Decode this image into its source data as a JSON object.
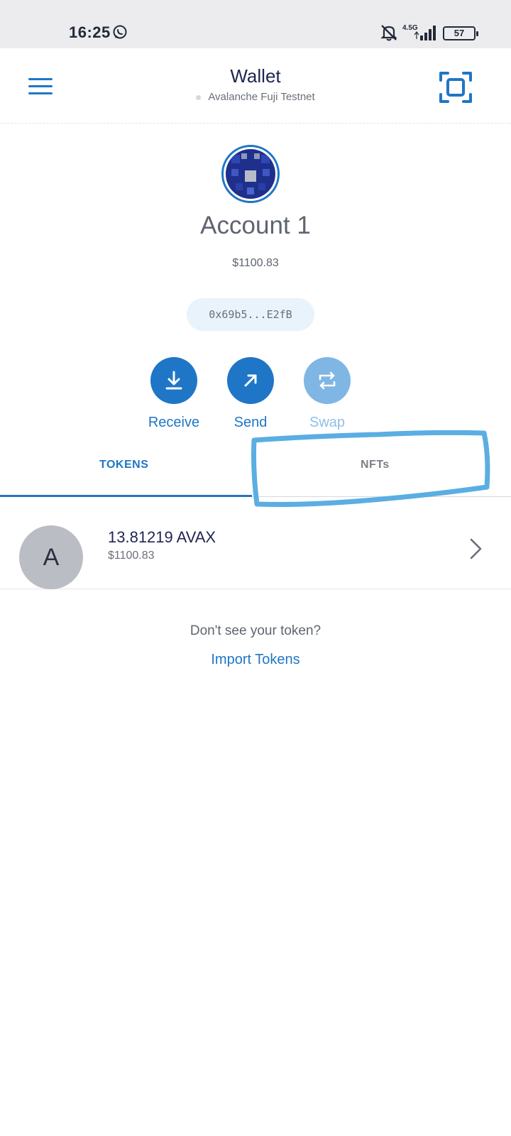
{
  "status_bar": {
    "time": "16:25",
    "network": "4.5G",
    "battery": "57"
  },
  "header": {
    "title": "Wallet",
    "network_name": "Avalanche Fuji Testnet"
  },
  "account": {
    "name": "Account 1",
    "balance": "$1100.83",
    "address": "0x69b5...E2fB"
  },
  "actions": {
    "receive": "Receive",
    "send": "Send",
    "swap": "Swap"
  },
  "tabs": {
    "tokens": "TOKENS",
    "nfts": "NFTs",
    "active": "TOKENS"
  },
  "tokens": [
    {
      "icon_letter": "A",
      "amount": "13.81219 AVAX",
      "fiat": "$1100.83"
    }
  ],
  "empty_state": {
    "prompt": "Don't see your token?",
    "link": "Import Tokens"
  },
  "colors": {
    "accent": "#1f76c6",
    "highlight_annotation": "#5aaee2"
  },
  "icons": {
    "menu": "hamburger-menu-icon",
    "scan": "scan-qr-icon",
    "receive": "download-arrow-icon",
    "send": "send-arrow-icon",
    "swap": "swap-arrows-icon",
    "row": "chevron-right-icon"
  }
}
